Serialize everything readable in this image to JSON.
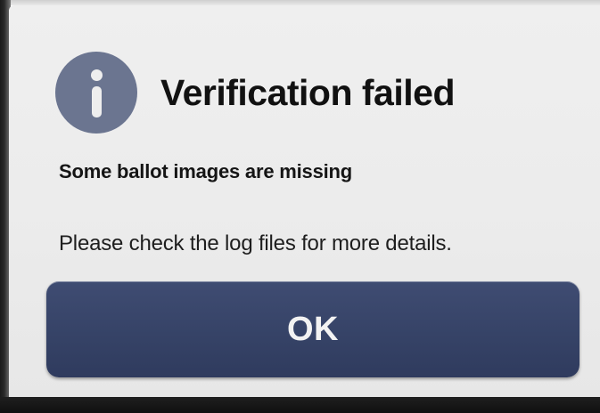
{
  "dialog": {
    "title": "Verification failed",
    "subtitle": "Some ballot images are missing",
    "message": "Please check the log files for more details.",
    "ok_label": "OK",
    "icon": "info-icon"
  },
  "colors": {
    "background": "#ececec",
    "icon": "#6b7590",
    "button": "#364367",
    "button_text": "#f2f2f2",
    "text": "#111111"
  }
}
